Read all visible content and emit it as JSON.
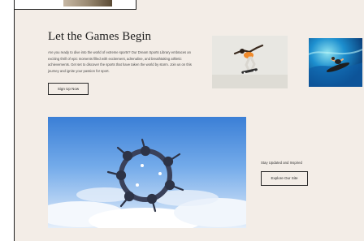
{
  "hero": {
    "title": "Let the Games Begin",
    "description": "Are you ready to dive into the world of extreme sports? Our Dream Sports Library embraces an exciting thrill of epic moments filled with excitement, adrenaline, and breathtaking athletic achievements. Get set to discover the sports that have taken the world by storm. Join us on this journey and ignite your passion for sport.",
    "signup_label": "Sign Up Now"
  },
  "images": {
    "skateboard": "skateboarder-photo",
    "surf": "surfer-photo",
    "skydive": "skydivers-photo"
  },
  "stay_updated": {
    "label": "Stay Updated and Inspired",
    "button_label": "Explore Our Site"
  },
  "colors": {
    "background": "#f3ede7",
    "text": "#1f1f1f",
    "border": "#2a2a2a"
  }
}
